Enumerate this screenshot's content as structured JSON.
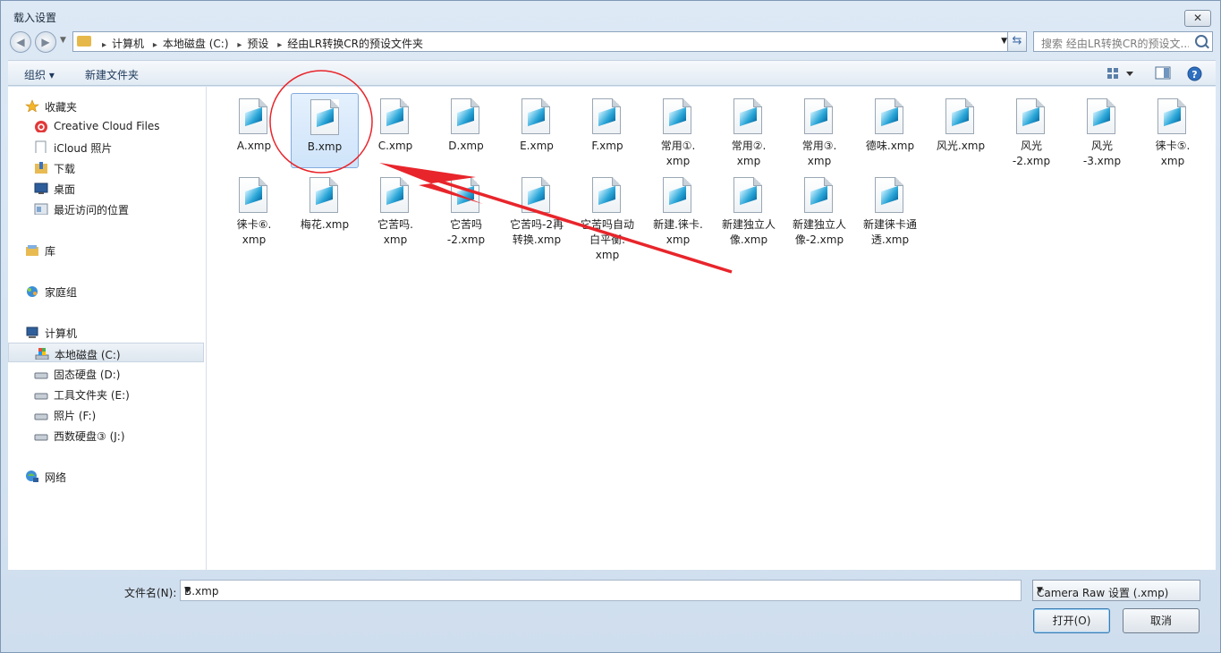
{
  "window": {
    "title": "载入设置",
    "close_glyph": "✕"
  },
  "nav": {
    "back_glyph": "◀",
    "forward_glyph": "▶",
    "breadcrumbs": [
      "计算机",
      "本地磁盘 (C:)",
      "预设",
      "经由LR转换CR的预设文件夹"
    ],
    "search_placeholder": "搜索 经由LR转换CR的预设文..."
  },
  "toolbar": {
    "organize": "组织 ▾",
    "new_folder": "新建文件夹"
  },
  "sidebar": {
    "favorites": "收藏夹",
    "favorites_items": [
      "Creative Cloud Files",
      "iCloud 照片",
      "下载",
      "桌面",
      "最近访问的位置"
    ],
    "libraries": "库",
    "homegroup": "家庭组",
    "computer": "计算机",
    "drives": [
      "本地磁盘 (C:)",
      "固态硬盘 (D:)",
      "工具文件夹 (E:)",
      "照片 (F:)",
      "西数硬盘③ (J:)"
    ],
    "network": "网络"
  },
  "files": [
    {
      "name": "A.xmp"
    },
    {
      "name": "B.xmp",
      "selected": true
    },
    {
      "name": "C.xmp"
    },
    {
      "name": "D.xmp"
    },
    {
      "name": "E.xmp"
    },
    {
      "name": "F.xmp"
    },
    {
      "name": "常用①.xmp"
    },
    {
      "name": "常用②.xmp"
    },
    {
      "name": "常用③.xmp"
    },
    {
      "name": "德味.xmp"
    },
    {
      "name": "风光.xmp"
    },
    {
      "name": "风光-2.xmp"
    },
    {
      "name": "风光-3.xmp"
    },
    {
      "name": "徕卡⑤.xmp"
    },
    {
      "name": "徕卡⑥.xmp"
    },
    {
      "name": "梅花.xmp"
    },
    {
      "name": "它苦吗.xmp"
    },
    {
      "name": "它苦吗-2.xmp"
    },
    {
      "name": "它苦吗-2再转换.xmp"
    },
    {
      "name": "它苦吗自动白平衡.xmp"
    },
    {
      "name": "新建.徕卡.xmp"
    },
    {
      "name": "新建独立人像.xmp"
    },
    {
      "name": "新建独立人像-2.xmp"
    },
    {
      "name": "新建徕卡通透.xmp"
    }
  ],
  "file_labels": [
    "A.xmp",
    "B.xmp",
    "C.xmp",
    "D.xmp",
    "E.xmp",
    "F.xmp",
    "常用①.\nxmp",
    "常用②.\nxmp",
    "常用③.\nxmp",
    "德味.xmp",
    "风光.xmp",
    "风光\n-2.xmp",
    "风光\n-3.xmp",
    "徕卡⑤.\nxmp",
    "徕卡⑥.\nxmp",
    "梅花.xmp",
    "它苦吗.\nxmp",
    "它苦吗\n-2.xmp",
    "它苦吗-2再\n转换.xmp",
    "它苦吗自动\n白平衡.\nxmp",
    "新建.徕卡.\nxmp",
    "新建独立人\n像.xmp",
    "新建独立人\n像-2.xmp",
    "新建徕卡通\n透.xmp"
  ],
  "bottom": {
    "filename_label": "文件名(N):",
    "filename_value": "B.xmp",
    "filetype": "Camera Raw 设置 (.xmp)",
    "open_button": "打开(O)",
    "cancel_button": "取消"
  },
  "colors": {
    "annotation": "#e8252b",
    "selection": "#cfe4fa"
  }
}
